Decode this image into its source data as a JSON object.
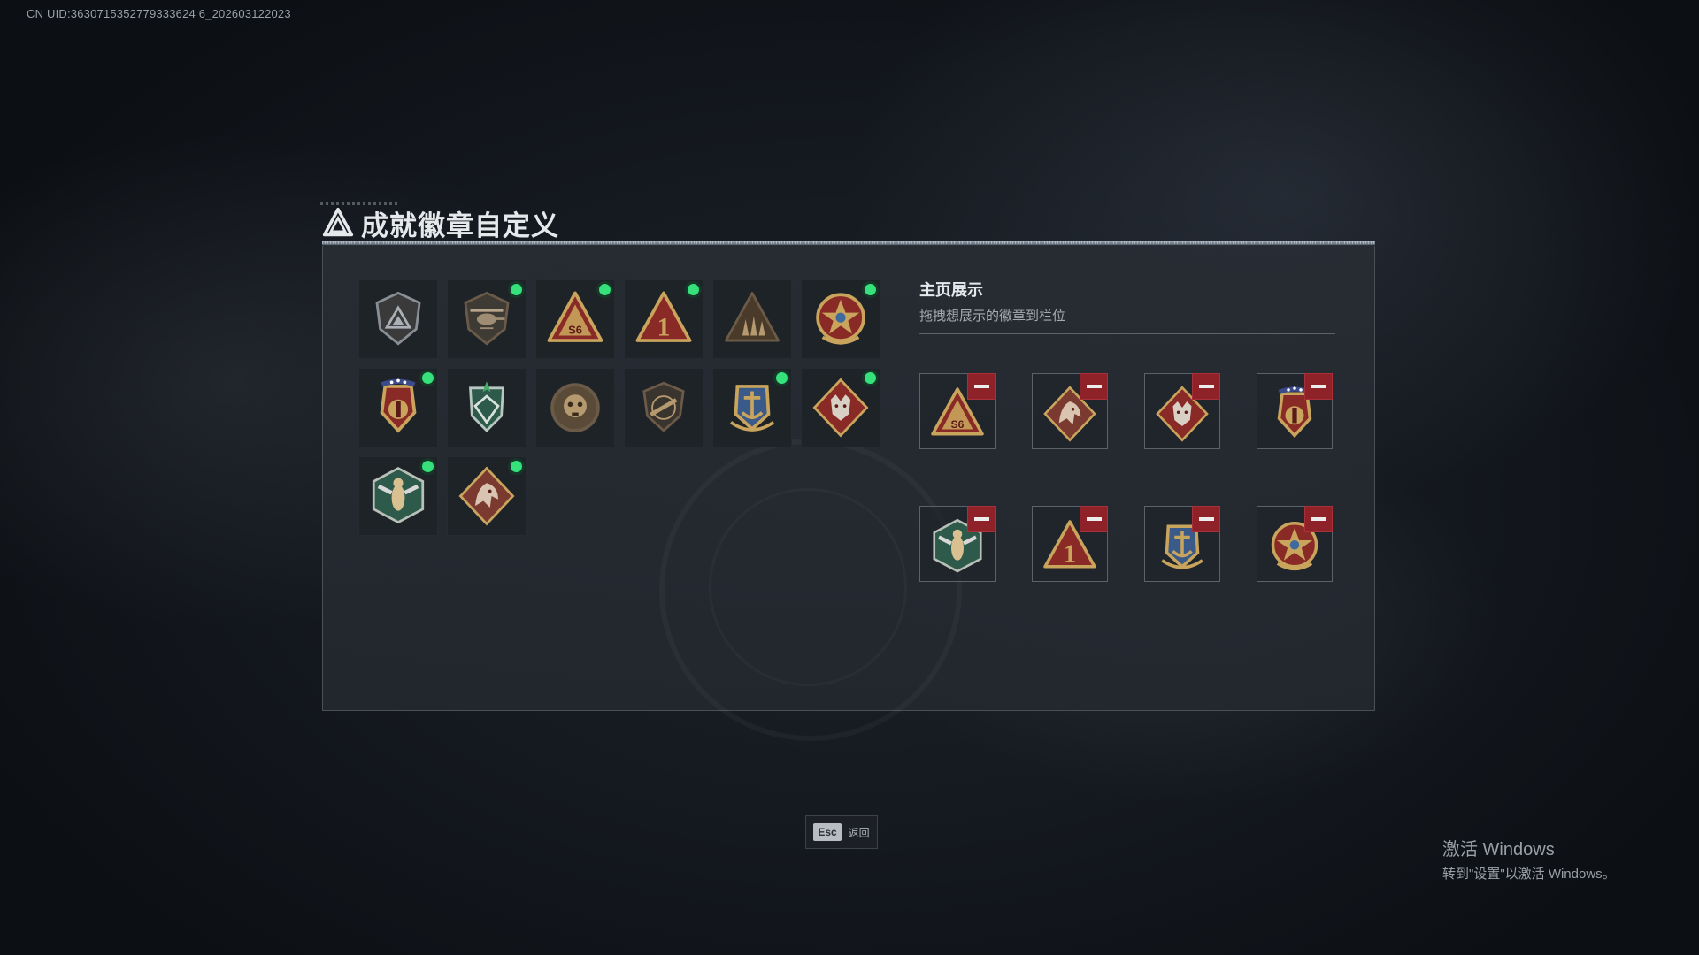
{
  "uid": "CN UID:3630715352779333624 6_202603122023",
  "header": {
    "title": "成就徽章自定义",
    "logo_icon": "delta-triangle-logo-icon"
  },
  "badges": [
    {
      "icon": "shield-triangle-badge-icon",
      "new": false
    },
    {
      "icon": "helicopter-badge-icon",
      "new": true
    },
    {
      "icon": "s6-triangle-badge-icon",
      "new": true
    },
    {
      "icon": "number-one-triangle-badge-icon",
      "new": true
    },
    {
      "icon": "soldiers-triangle-badge-icon",
      "new": false
    },
    {
      "icon": "star-wreath-medal-icon",
      "new": true
    },
    {
      "icon": "crest-wings-medal-icon",
      "new": true
    },
    {
      "icon": "green-shield-star-badge-icon",
      "new": false
    },
    {
      "icon": "bronze-skull-medallion-icon",
      "new": false
    },
    {
      "icon": "rifle-shield-badge-icon",
      "new": false
    },
    {
      "icon": "anchor-wreath-badge-icon",
      "new": true
    },
    {
      "icon": "wolf-diamond-badge-icon",
      "new": true
    },
    {
      "icon": "hornet-hexagon-badge-icon",
      "new": true
    },
    {
      "icon": "dragon-diamond-badge-icon",
      "new": true
    }
  ],
  "showcase": {
    "title": "主页展示",
    "subtitle": "拖拽想展示的徽章到栏位",
    "slots": [
      {
        "icon": "s6-triangle-badge-icon"
      },
      {
        "icon": "dragon-diamond-badge-icon"
      },
      {
        "icon": "wolf-diamond-badge-icon"
      },
      {
        "icon": "crest-wings-medal-icon"
      },
      {
        "icon": "hornet-hexagon-badge-icon"
      },
      {
        "icon": "number-one-triangle-badge-icon"
      },
      {
        "icon": "anchor-wreath-badge-icon"
      },
      {
        "icon": "star-wreath-medal-icon"
      }
    ],
    "remove_icon": "minus-icon"
  },
  "footer": {
    "esc_key": "Esc",
    "esc_label": "返回"
  },
  "watermark": {
    "line1": "激活 Windows",
    "line2": "转到\"设置\"以激活 Windows。"
  },
  "colors": {
    "new_dot": "#36e07a",
    "remove_button": "#8f2228",
    "gold": "#c9a45c",
    "panel_border": "#4a5058"
  }
}
